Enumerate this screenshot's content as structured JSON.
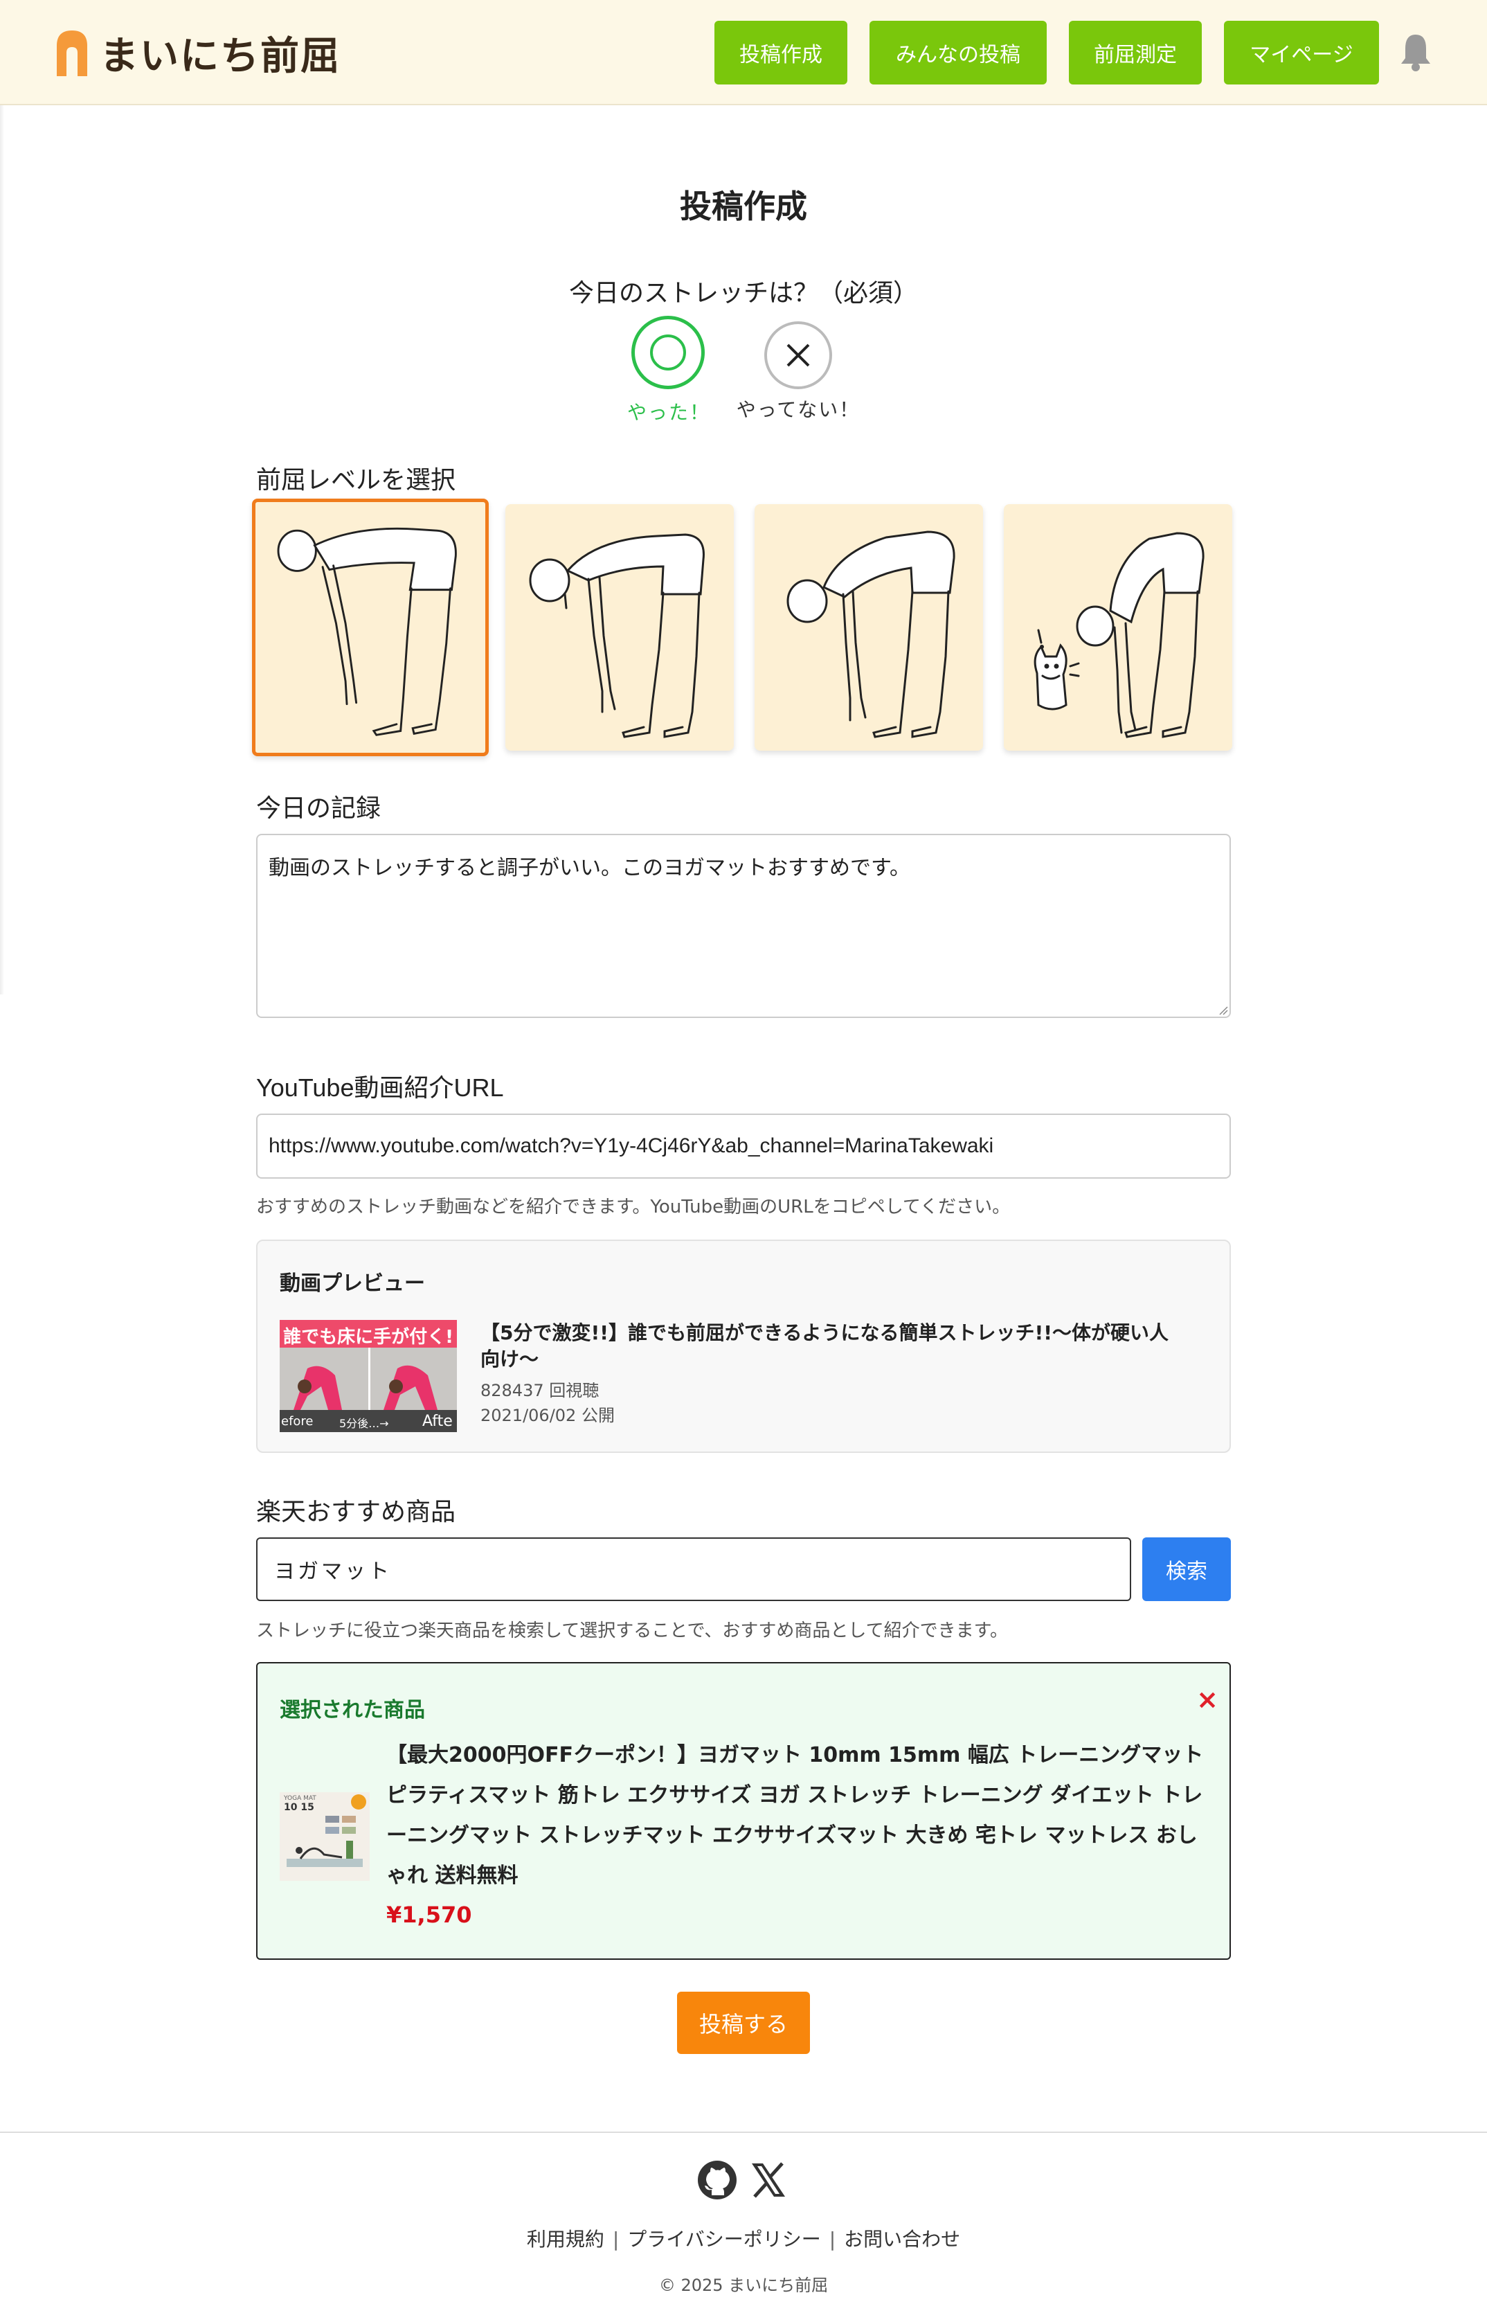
{
  "header": {
    "logo_text": "まいにち前屈",
    "nav": [
      "投稿作成",
      "みんなの投稿",
      "前屈測定",
      "マイページ"
    ],
    "accent_color": "#7ac70c",
    "bell_icon": "bell-icon"
  },
  "main": {
    "title": "投稿作成",
    "question": "今日のストレッチは？（必須）",
    "choices": {
      "yes": "やった！",
      "no": "やってない！"
    },
    "level_label": "前屈レベルを選択",
    "levels_selected_index": 0,
    "record_label": "今日の記録",
    "record_value": "動画のストレッチすると調子がいい。このヨガマットおすすめです。",
    "youtube_label": "YouTube動画紹介URL",
    "youtube_url": "https://www.youtube.com/watch?v=Y1y-4Cj46rY&ab_channel=MarinaTakewaki",
    "youtube_help": "おすすめのストレッチ動画などを紹介できます。YouTube動画のURLをコピペしてください。",
    "preview": {
      "title": "動画プレビュー",
      "video_title": "【5分で激変!!】誰でも前屈ができるようになる簡単ストレッチ!!〜体が硬い人向け〜",
      "views": "828437 回視聴",
      "date": "2021/06/02 公開",
      "thumb_banner": "誰でも床に手が付く!",
      "thumb_before": "efore",
      "thumb_mid": "5分後…→",
      "thumb_after": "Afte"
    },
    "rakuten_label": "楽天おすすめ商品",
    "search_value": "ヨガマット",
    "search_button": "検索",
    "rakuten_help": "ストレッチに役立つ楽天商品を検索して選択することで、おすすめ商品として紹介できます。",
    "selected": {
      "title": "選択された商品",
      "close": "×",
      "product_name": "【最大2000円OFFクーポン！】ヨガマット 10mm 15mm 幅広 トレーニングマット ピラティスマット 筋トレ エクササイズ ヨガ ストレッチ トレーニング ダイエット トレーニングマット ストレッチマット エクササイズマット 大きめ 宅トレ マットレス おしゃれ 送料無料",
      "price": "¥1,570",
      "img_label": "YOGA MAT",
      "img_sizes": "10 15"
    },
    "submit": "投稿する"
  },
  "footer": {
    "icons": [
      "github-icon",
      "x-icon"
    ],
    "links": [
      "利用規約",
      "プライバシーポリシー",
      "お問い合わせ"
    ],
    "copyright": "© 2025 まいにち前屈"
  }
}
